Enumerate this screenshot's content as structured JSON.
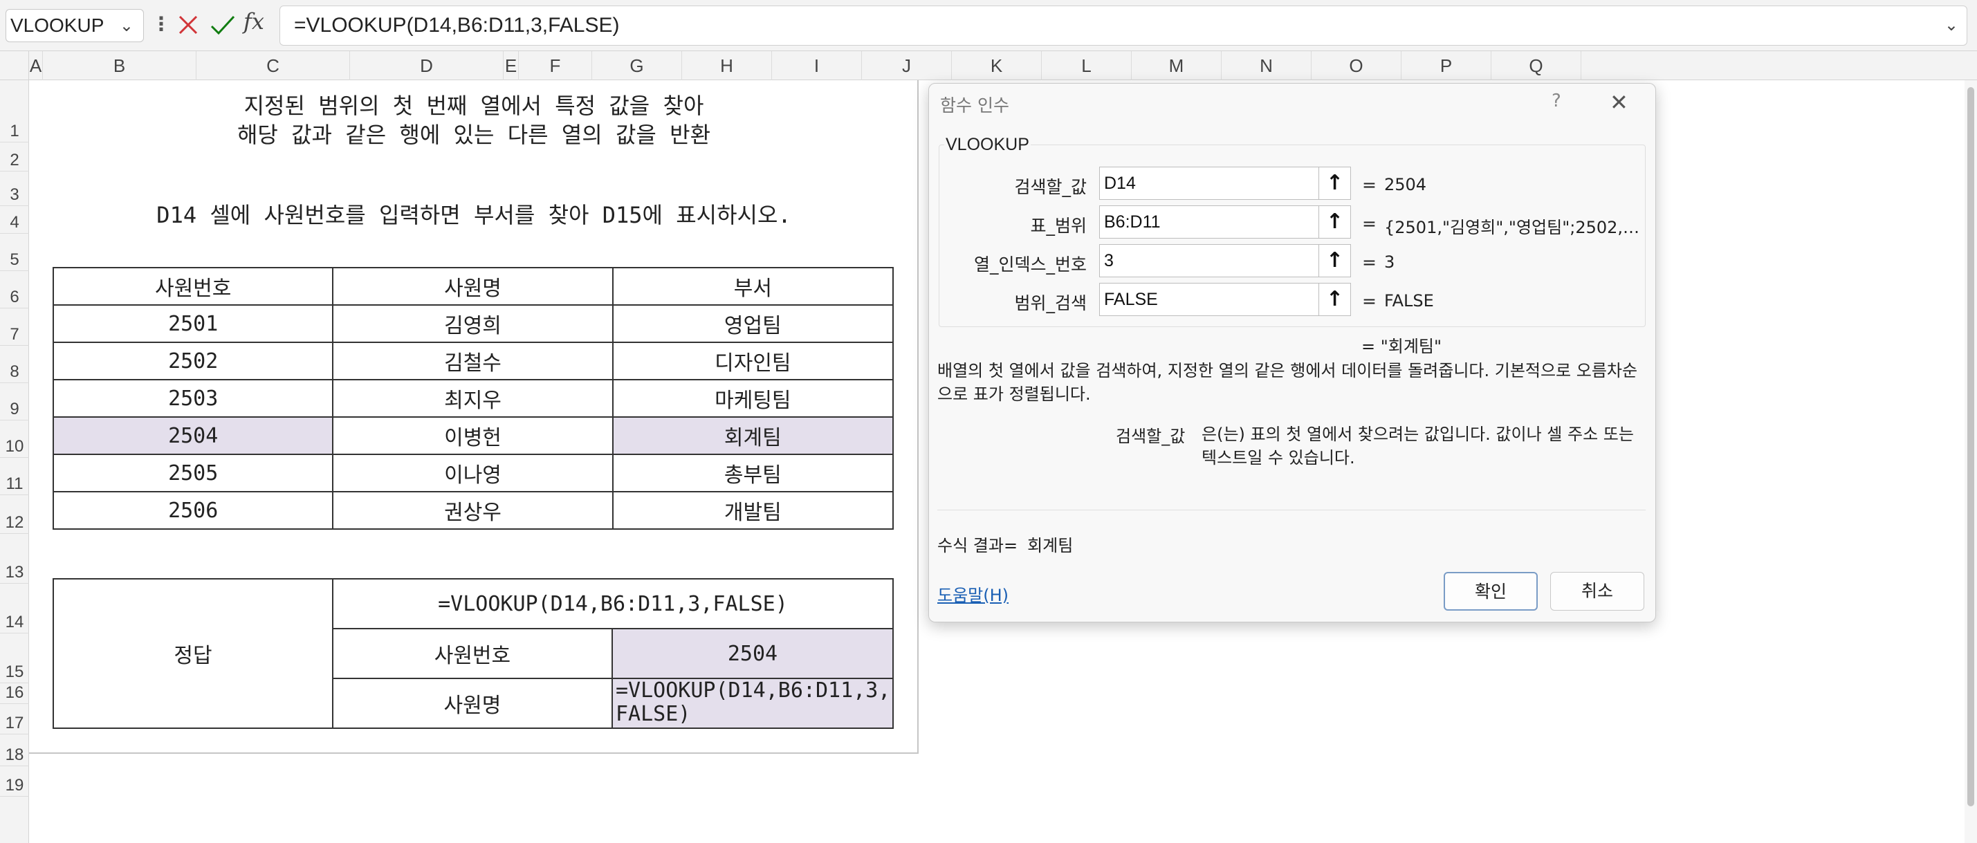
{
  "formula_bar": {
    "name_box": "VLOOKUP",
    "formula": "=VLOOKUP(D14,B6:D11,3,FALSE)",
    "fx_label": "fx"
  },
  "columns": [
    "A",
    "B",
    "C",
    "D",
    "E",
    "F",
    "G",
    "H",
    "I",
    "J",
    "K",
    "L",
    "M",
    "N",
    "O",
    "P",
    "Q"
  ],
  "rows": [
    "1",
    "2",
    "3",
    "4",
    "5",
    "6",
    "7",
    "8",
    "9",
    "10",
    "11",
    "12",
    "13",
    "14",
    "15",
    "16",
    "17",
    "18",
    "19"
  ],
  "sheet": {
    "title_line1": "지정된 범위의 첫 번째 열에서 특정 값을 찾아",
    "title_line2": "해당 값과 같은 행에 있는 다른 열의 값을 반환",
    "instruction": "D14 셀에 사원번호를 입력하면 부서를 찾아 D15에 표시하시오.",
    "table_headers": [
      "사원번호",
      "사원명",
      "부서"
    ],
    "table_rows": [
      [
        "2501",
        "김영희",
        "영업팀"
      ],
      [
        "2502",
        "김철수",
        "디자인팀"
      ],
      [
        "2503",
        "최지우",
        "마케팅팀"
      ],
      [
        "2504",
        "이병헌",
        "회계팀"
      ],
      [
        "2505",
        "이나영",
        "총부팀"
      ],
      [
        "2506",
        "권상우",
        "개발팀"
      ]
    ],
    "answer": {
      "label": "정답",
      "formula": "=VLOOKUP(D14,B6:D11,3,FALSE)",
      "emp_no_label": "사원번호",
      "emp_no_value": "2504",
      "emp_name_label": "사원명",
      "cell_line1": "=VLOOKUP(D14,B6:D11,3,",
      "cell_line2": "FALSE)"
    }
  },
  "dialog": {
    "title": "함수 인수",
    "help_q": "?",
    "function_name": "VLOOKUP",
    "args": [
      {
        "label": "검색할_값",
        "input": "D14",
        "value": "2504"
      },
      {
        "label": "표_범위",
        "input": "B6:D11",
        "value": "{2501,\"김영희\",\"영업팀\";2502,\"..."
      },
      {
        "label": "열_인덱스_번호",
        "input": "3",
        "value": "3"
      },
      {
        "label": "범위_검색",
        "input": "FALSE",
        "value": "FALSE"
      }
    ],
    "eq": "=",
    "result_line": "= \"회계팀\"",
    "description": "배열의 첫 열에서 값을 검색하여, 지정한 열의 같은 행에서 데이터를 돌려줍니다. 기본적으로 오름차순으로 표가 정렬됩니다.",
    "arg_help_label": "검색할_값",
    "arg_help_text": "은(는) 표의 첫 열에서 찾으려는 값입니다. 값이나 셀 주소 또는 텍스트일 수 있습니다.",
    "formula_result_label": "수식 결과=",
    "formula_result_value": "회계팀",
    "help_link": "도움말(H)",
    "ok": "확인",
    "cancel": "취소"
  }
}
